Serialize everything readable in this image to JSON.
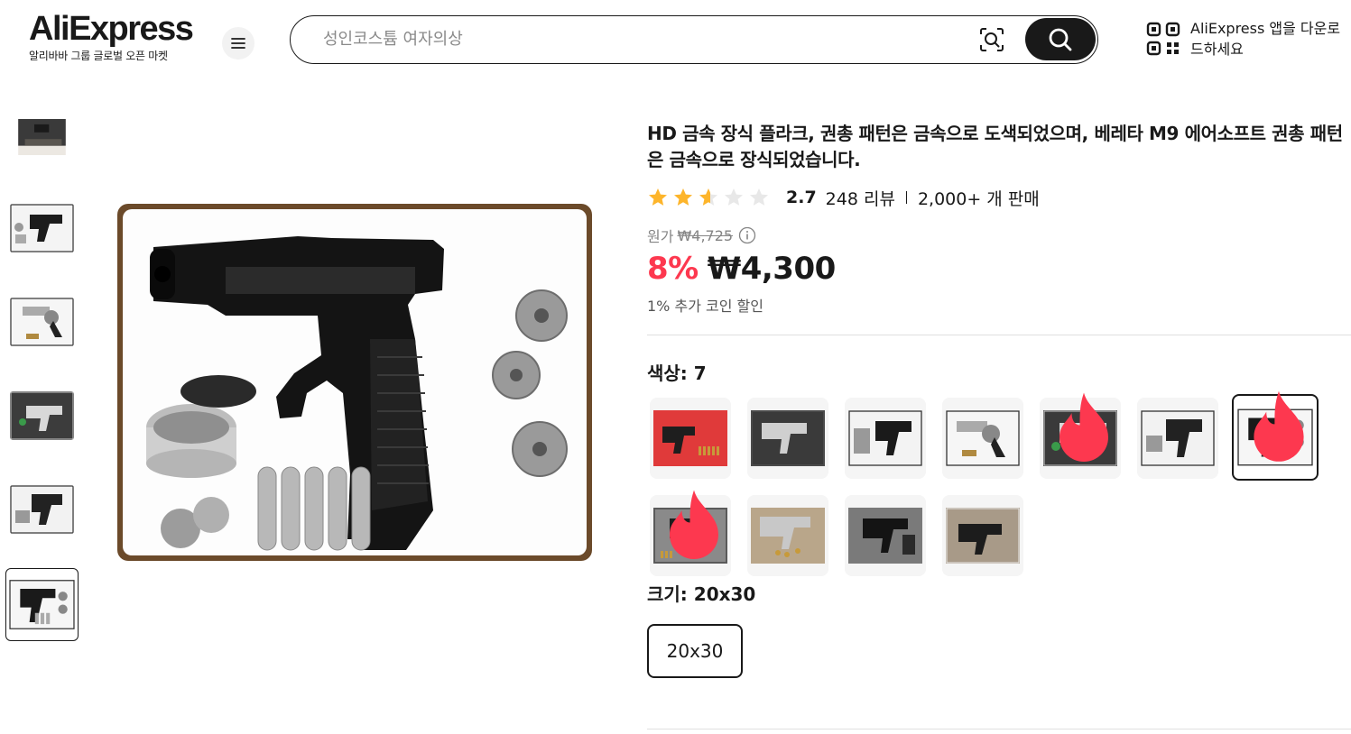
{
  "header": {
    "logo_text_prefix": "Ali",
    "logo_text_suffix": "Express",
    "logo_subtitle": "알리바바 그룹 글로벌 오픈 마켓",
    "search_placeholder": "성인코스튬 여자의상",
    "app_download_text": "AliExpress 앱을 다운로드하세요"
  },
  "product": {
    "title": "HD 금속 장식 플라크, 권총 패턴은 금속으로 도색되었으며, 베레타 M9 에어소프트 권총 패턴은 금속으로 장식되었습니다.",
    "rating": "2.7",
    "rating_value": 2.7,
    "reviews": "248 리뷰",
    "sold": "2,000+ 개 판매",
    "original_price_label": "원가",
    "original_price": "₩4,725",
    "discount": "8%",
    "price": "₩4,300",
    "coin_discount": "1% 추가 코인 할인"
  },
  "color_option": {
    "label": "색상:",
    "value": "7",
    "swatch_count": 11,
    "selected_index": 6,
    "hot_indices": [
      4,
      6,
      7
    ]
  },
  "size_option": {
    "label": "크기:",
    "value": "20x30",
    "options": [
      "20x30"
    ]
  },
  "gallery": {
    "thumbnail_count": 6,
    "active_index": 5
  },
  "colors": {
    "accent_red": "#fd384f",
    "primary_black": "#191919",
    "star_gold": "#fdb52b"
  }
}
